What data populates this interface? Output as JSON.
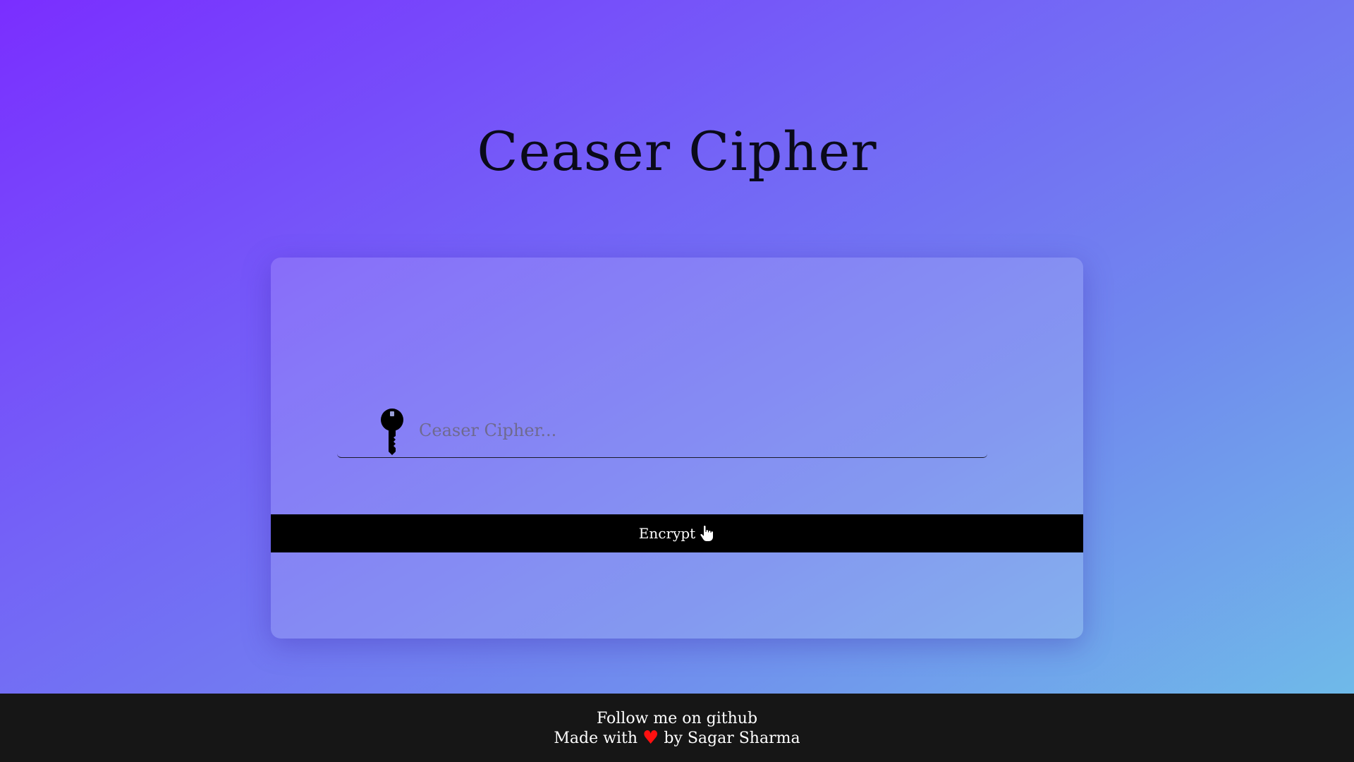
{
  "header": {
    "title": "Ceaser Cipher"
  },
  "form": {
    "input_placeholder": "Ceaser Cipher...",
    "input_value": "",
    "encrypt_label": "Encrypt",
    "key_icon": "key-icon",
    "button_icon": "pointing-hand-icon"
  },
  "footer": {
    "follow_text": "Follow me on github",
    "made_with_text": "Made with",
    "heart_glyph": "♥",
    "by_text": "by Sagar Sharma"
  },
  "colors": {
    "gradient_start": "#7a2eff",
    "gradient_end": "#6fc1e8",
    "button_bg": "#000000",
    "footer_bg": "#161616",
    "heart": "#ff1010"
  }
}
